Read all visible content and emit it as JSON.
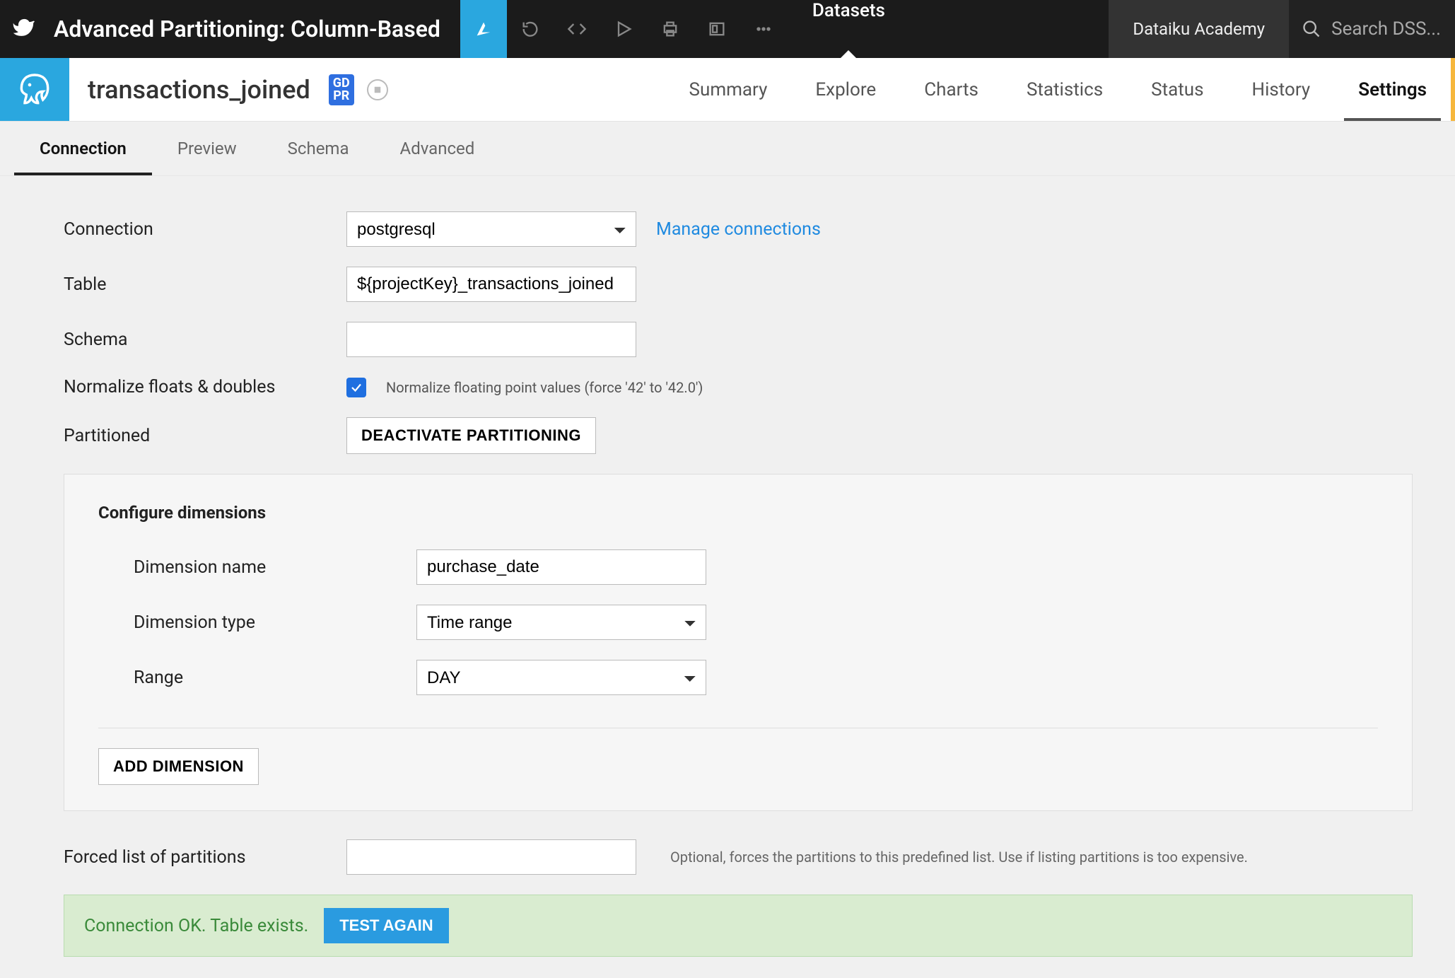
{
  "topbar": {
    "project_title": "Advanced Partitioning: Column-Based",
    "datasets_label": "Datasets",
    "academy_label": "Dataiku Academy",
    "search_placeholder": "Search DSS..."
  },
  "dataset": {
    "name": "transactions_joined",
    "gdpr_badge_top": "GD",
    "gdpr_badge_bot": "PR",
    "tabs": [
      "Summary",
      "Explore",
      "Charts",
      "Statistics",
      "Status",
      "History",
      "Settings"
    ],
    "active_tab": "Settings"
  },
  "subtabs": {
    "items": [
      "Connection",
      "Preview",
      "Schema",
      "Advanced"
    ],
    "active": "Connection"
  },
  "form": {
    "labels": {
      "connection": "Connection",
      "table": "Table",
      "schema": "Schema",
      "normalize": "Normalize floats & doubles",
      "partitioned": "Partitioned",
      "forced_list": "Forced list of partitions"
    },
    "connection_value": "postgresql",
    "manage_connections": "Manage connections",
    "table_value": "${projectKey}_transactions_joined",
    "schema_value": "",
    "normalize_help": "Normalize floating point values (force '42' to '42.0')",
    "deactivate_btn": "DEACTIVATE PARTITIONING",
    "forced_help": "Optional, forces the partitions to this predefined list. Use if listing partitions is too expensive.",
    "forced_value": ""
  },
  "dimensions": {
    "heading": "Configure dimensions",
    "labels": {
      "name": "Dimension name",
      "type": "Dimension type",
      "range": "Range"
    },
    "name_value": "purchase_date",
    "type_value": "Time range",
    "range_value": "DAY",
    "add_btn": "ADD DIMENSION"
  },
  "status": {
    "text": "Connection OK. Table exists.",
    "btn": "TEST AGAIN"
  }
}
